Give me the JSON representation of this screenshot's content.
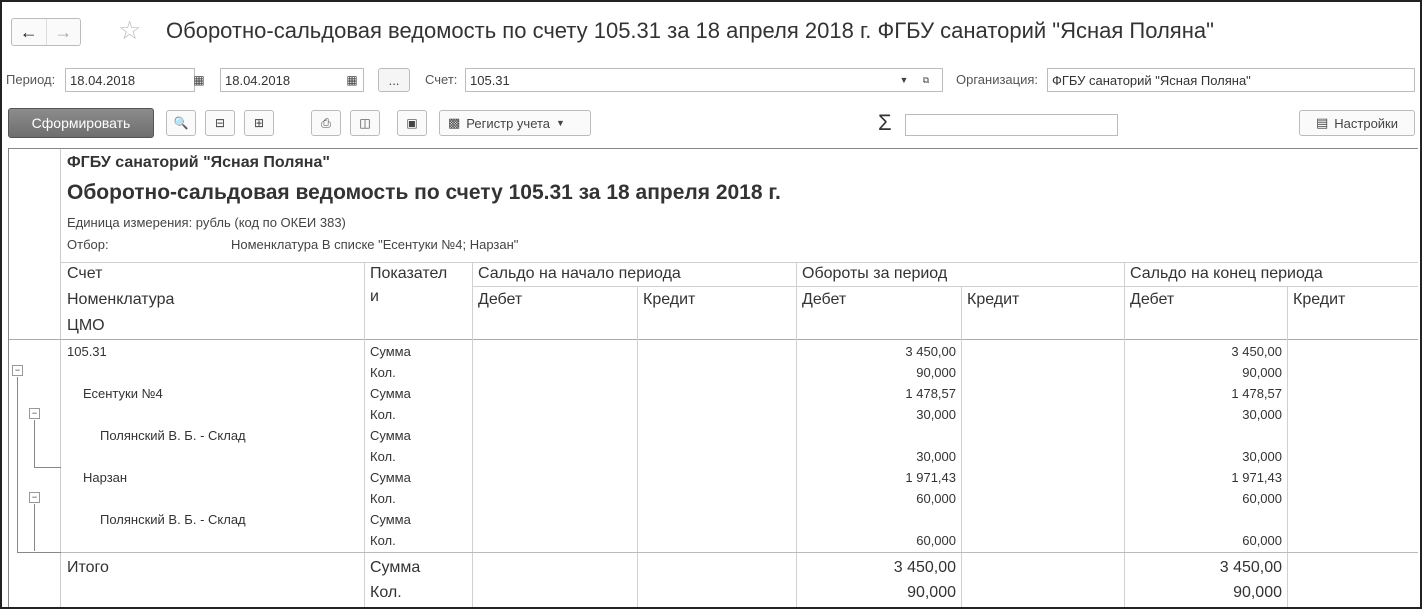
{
  "window": {
    "title": "Оборотно-сальдовая ведомость по счету 105.31 за 18 апреля 2018 г. ФГБУ санаторий \"Ясная Поляна\""
  },
  "params": {
    "period_label": "Период:",
    "date_from": "18.04.2018",
    "date_to": "18.04.2018",
    "dots": "...",
    "account_label": "Счет:",
    "account": "105.31",
    "org_label": "Организация:",
    "org": "ФГБУ санаторий \"Ясная Поляна\""
  },
  "toolbar": {
    "generate": "Сформировать",
    "register": "Регистр учета",
    "sigma": "Σ",
    "settings": "Настройки"
  },
  "report": {
    "org": "ФГБУ санаторий \"Ясная Поляна\"",
    "title": "Оборотно-сальдовая ведомость по счету 105.31 за 18 апреля 2018 г.",
    "unit": "Единица измерения: рубль (код по ОКЕИ 383)",
    "filter_label": "Отбор:",
    "filter_value": "Номенклатура В списке \"Есентуки №4; Нарзан\"",
    "headers": {
      "account": "Счет",
      "nomenclature": "Номенклатура",
      "cmo": "ЦМО",
      "indicator_1": "Показател",
      "indicator_2": "и",
      "opening": "Сальдо на начало периода",
      "turnover": "Обороты за период",
      "closing": "Сальдо на конец периода",
      "debit": "Дебет",
      "credit": "Кредит"
    },
    "rows": [
      {
        "name": "105.31",
        "ind": "Сумма",
        "turn_d": "3 450,00",
        "close_d": "3 450,00"
      },
      {
        "name": "",
        "ind": "Кол.",
        "turn_d": "90,000",
        "close_d": "90,000"
      },
      {
        "name": "Есентуки №4",
        "ind": "Сумма",
        "turn_d": "1 478,57",
        "close_d": "1 478,57"
      },
      {
        "name": "",
        "ind": "Кол.",
        "turn_d": "30,000",
        "close_d": "30,000"
      },
      {
        "name": "Полянский В. Б. - Склад",
        "ind": "Сумма",
        "turn_d": "",
        "close_d": ""
      },
      {
        "name": "",
        "ind": "Кол.",
        "turn_d": "30,000",
        "close_d": "30,000"
      },
      {
        "name": "Нарзан",
        "ind": "Сумма",
        "turn_d": "1 971,43",
        "close_d": "1 971,43"
      },
      {
        "name": "",
        "ind": "Кол.",
        "turn_d": "60,000",
        "close_d": "60,000"
      },
      {
        "name": "Полянский В. Б. - Склад",
        "ind": "Сумма",
        "turn_d": "",
        "close_d": ""
      },
      {
        "name": "",
        "ind": "Кол.",
        "turn_d": "60,000",
        "close_d": "60,000"
      }
    ],
    "total": {
      "label": "Итого",
      "ind_sum": "Сумма",
      "ind_qty": "Кол.",
      "turn_sum": "3 450,00",
      "close_sum": "3 450,00",
      "turn_qty": "90,000",
      "close_qty": "90,000"
    }
  }
}
